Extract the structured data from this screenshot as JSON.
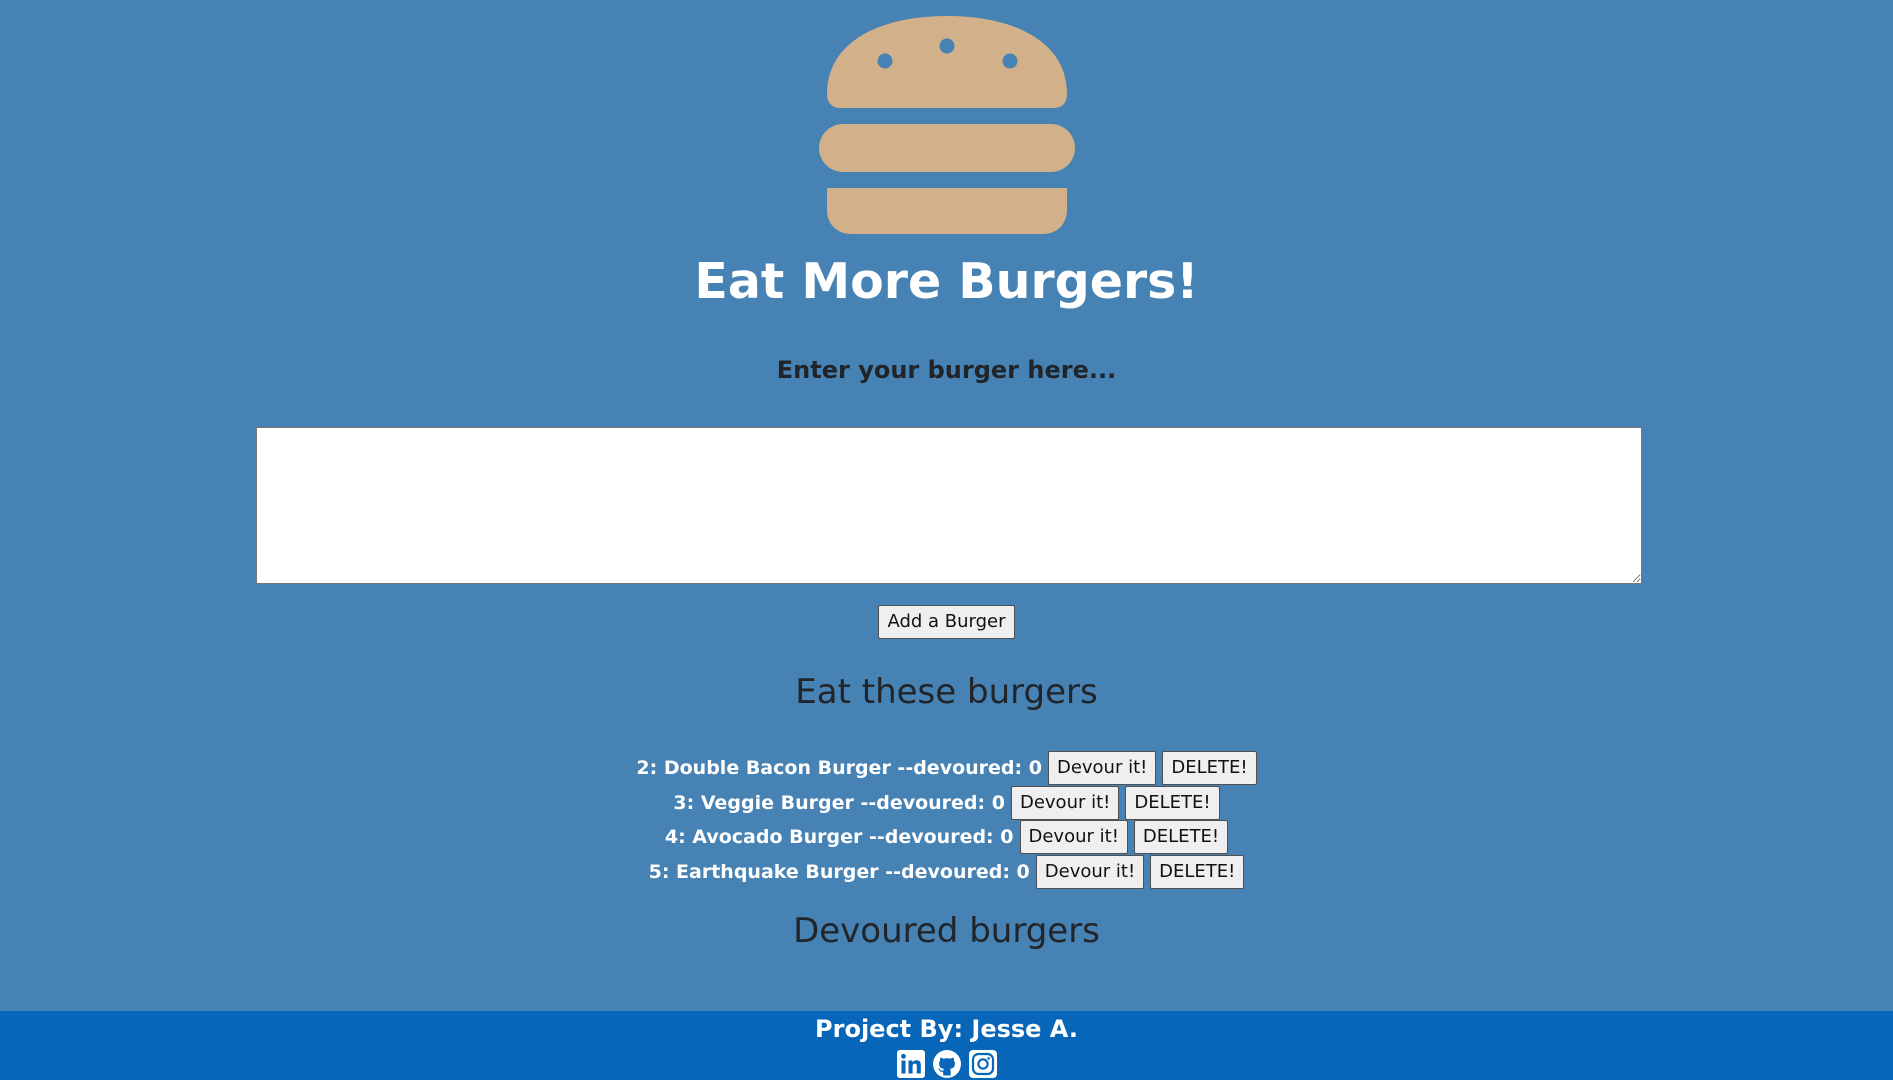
{
  "logo": {
    "icon": "hamburger-icon",
    "color": "#d2b08a"
  },
  "header": {
    "title": "Eat More Burgers!",
    "subtitle": "Enter your burger here..."
  },
  "form": {
    "input_value": "",
    "add_button_label": "Add a Burger"
  },
  "eat_section": {
    "heading": "Eat these burgers",
    "burgers": [
      {
        "label": "2: Double Bacon Burger --devoured: 0",
        "devour_label": "Devour it!",
        "delete_label": "DELETE!"
      },
      {
        "label": "3: Veggie Burger --devoured: 0",
        "devour_label": "Devour it!",
        "delete_label": "DELETE!"
      },
      {
        "label": "4: Avocado Burger --devoured: 0",
        "devour_label": "Devour it!",
        "delete_label": "DELETE!"
      },
      {
        "label": "5: Earthquake Burger --devoured: 0",
        "devour_label": "Devour it!",
        "delete_label": "DELETE!"
      }
    ]
  },
  "devoured_section": {
    "heading": "Devoured burgers"
  },
  "footer": {
    "credit": "Project By: Jesse A.",
    "social_icons": [
      "linkedin-icon",
      "github-icon",
      "instagram-icon"
    ]
  },
  "colors": {
    "page_background": "#4682b4",
    "footer_background": "#0866b8",
    "title_text": "#ffffff",
    "dark_text": "#212529"
  }
}
